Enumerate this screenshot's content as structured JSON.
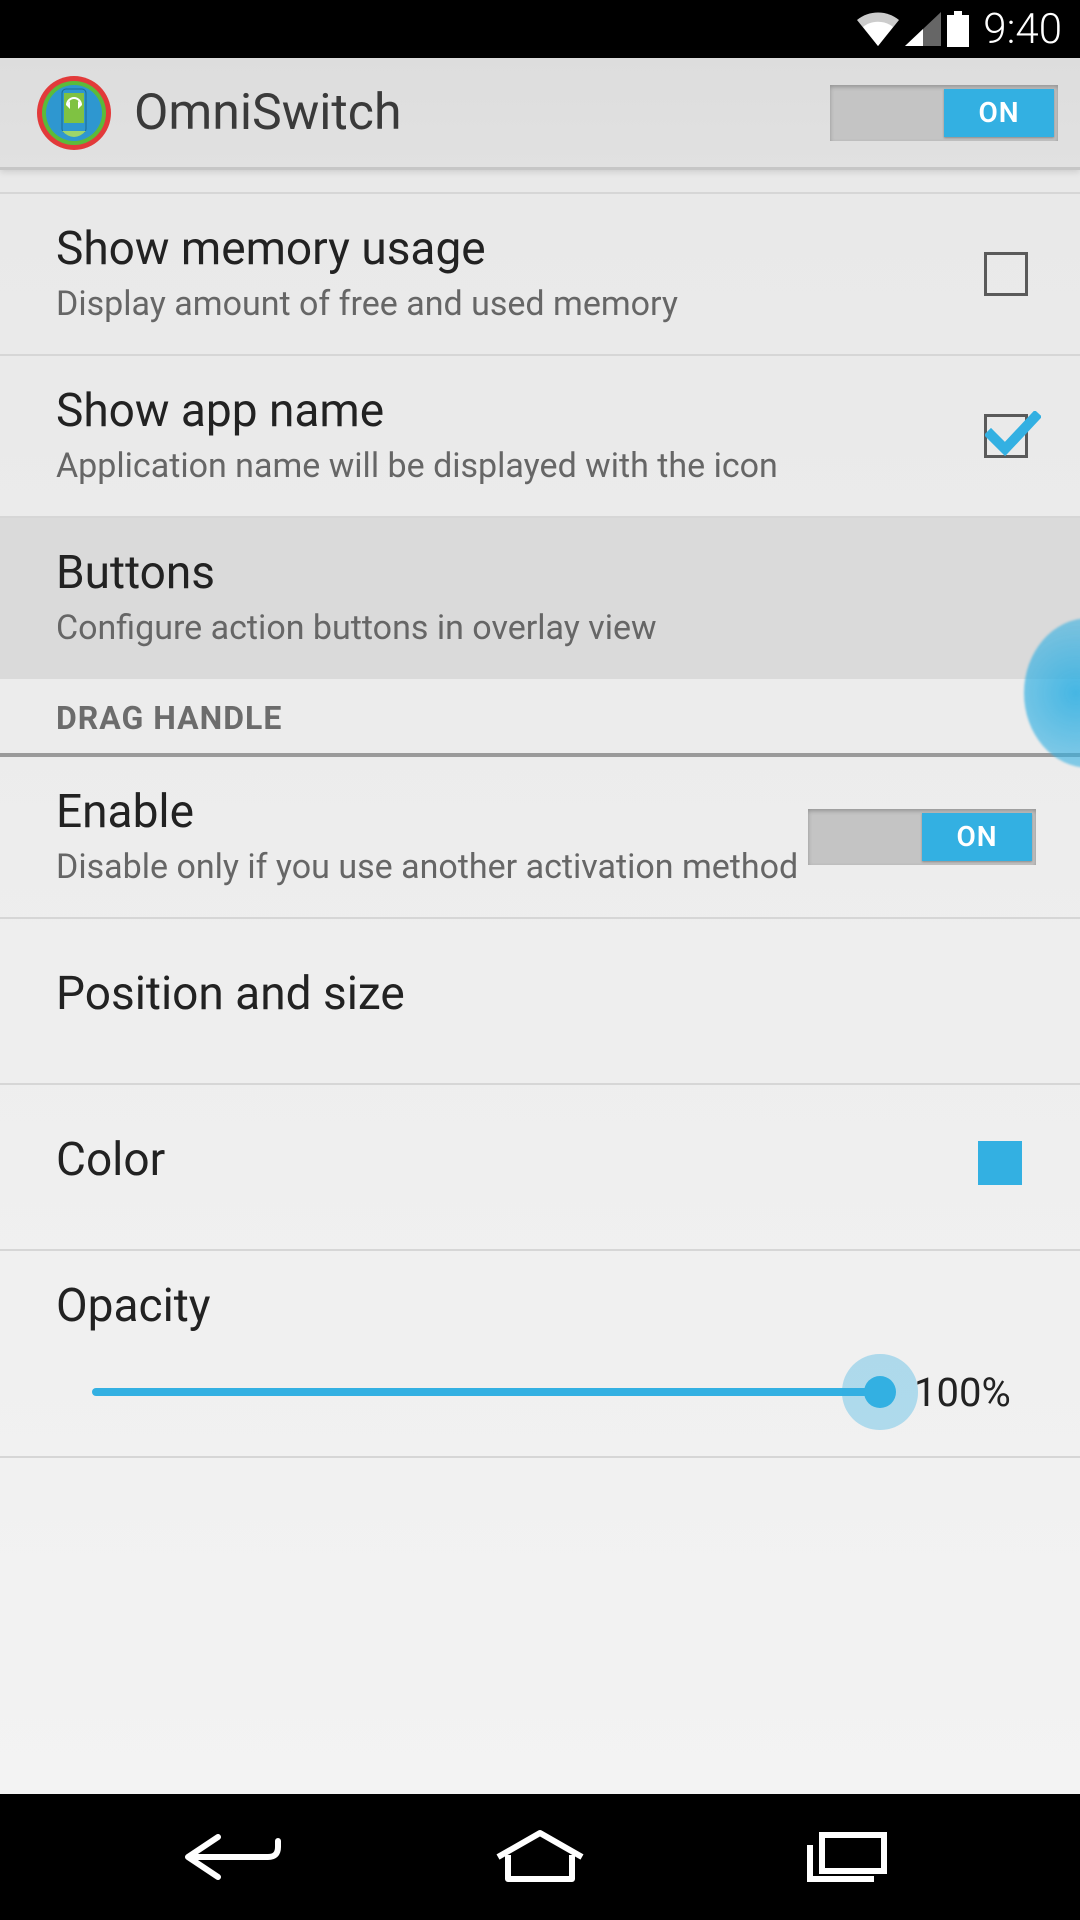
{
  "status": {
    "time": "9:40"
  },
  "header": {
    "title": "OmniSwitch",
    "toggle_label": "ON"
  },
  "settings": {
    "memory": {
      "title": "Show memory usage",
      "sub": "Display amount of free and used memory",
      "checked": false
    },
    "appname": {
      "title": "Show app name",
      "sub": "Application name will be displayed with the icon",
      "checked": true
    },
    "buttons": {
      "title": "Buttons",
      "sub": "Configure action buttons in overlay view"
    }
  },
  "section": {
    "drag_handle": "DRAG HANDLE"
  },
  "drag": {
    "enable": {
      "title": "Enable",
      "sub": "Disable only if you use another activation method",
      "toggle_label": "ON"
    },
    "position": {
      "title": "Position and size"
    },
    "color": {
      "title": "Color",
      "value": "#33B0E2"
    },
    "opacity": {
      "title": "Opacity",
      "value_label": "100%"
    }
  }
}
